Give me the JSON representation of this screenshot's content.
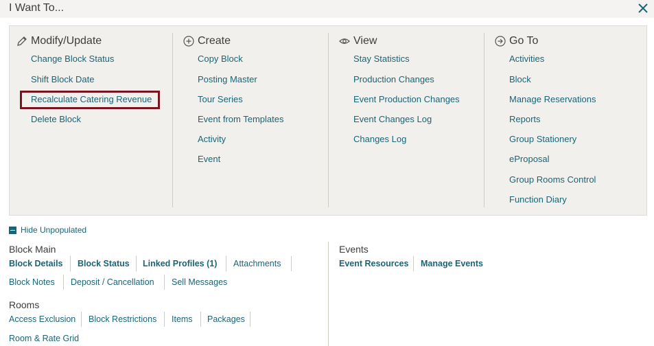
{
  "window": {
    "title": "I Want To..."
  },
  "columns": {
    "modify": {
      "heading": "Modify/Update",
      "items": [
        "Change Block Status",
        "Shift Block Date",
        "Recalculate Catering Revenue",
        "Delete Block"
      ]
    },
    "create": {
      "heading": "Create",
      "items": [
        "Copy Block",
        "Posting Master",
        "Tour Series",
        "Event from Templates",
        "Activity",
        "Event"
      ]
    },
    "view": {
      "heading": "View",
      "items": [
        "Stay Statistics",
        "Production Changes",
        "Event Production Changes",
        "Event Changes Log",
        "Changes Log"
      ]
    },
    "goto": {
      "heading": "Go To",
      "items": [
        "Activities",
        "Block",
        "Manage Reservations",
        "Reports",
        "Group Stationery",
        "eProposal",
        "Group Rooms Control",
        "Function Diary"
      ]
    }
  },
  "hide_unpopulated": "Hide Unpopulated",
  "block_main": {
    "title": "Block Main",
    "links": [
      "Block Details",
      "Block Status",
      "Linked Profiles (1)",
      "Attachments",
      "Block Notes",
      "Deposit / Cancellation",
      "Sell Messages"
    ]
  },
  "rooms": {
    "title": "Rooms",
    "links": [
      "Access Exclusion",
      "Block Restrictions",
      "Items",
      "Packages",
      "Room & Rate Grid"
    ]
  },
  "events": {
    "title": "Events",
    "links": [
      "Event Resources",
      "Manage Events"
    ]
  },
  "colors": {
    "link": "#196577",
    "highlight": "#7b1421",
    "panel": "#f1f0ec"
  }
}
